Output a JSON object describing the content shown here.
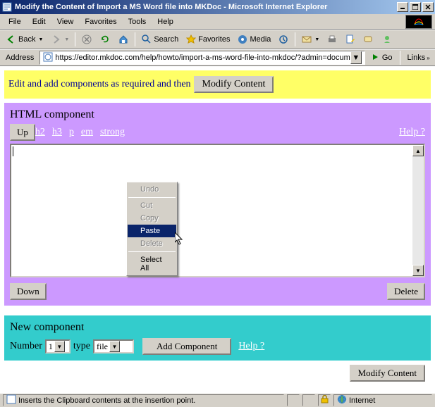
{
  "window": {
    "title": "Modify the Content of Import a MS Word file into MKDoc - Microsoft Internet Explorer"
  },
  "menubar": {
    "items": [
      "File",
      "Edit",
      "View",
      "Favorites",
      "Tools",
      "Help"
    ]
  },
  "toolbar": {
    "back": "Back",
    "search": "Search",
    "favorites": "Favorites",
    "media": "Media"
  },
  "addressbar": {
    "label": "Address",
    "url": "https://editor.mkdoc.com/help/howto/import-a-ms-word-file-into-mkdoc/?admin=docum",
    "go": "Go",
    "links": "Links"
  },
  "banner": {
    "text": "Edit and add components as required and then",
    "button": "Modify Content"
  },
  "html_component": {
    "title": "HTML component",
    "up": "Up",
    "tags": [
      "h2",
      "h3",
      "p",
      "em",
      "strong"
    ],
    "help": "Help ?",
    "down": "Down",
    "delete": "Delete"
  },
  "new_component": {
    "title": "New component",
    "number_label": "Number",
    "number_value": "1",
    "type_label": "type",
    "type_value": "file",
    "add": "Add Component",
    "help": "Help ?"
  },
  "bottom": {
    "modify": "Modify Content"
  },
  "context_menu": {
    "undo": "Undo",
    "cut": "Cut",
    "copy": "Copy",
    "paste": "Paste",
    "delete": "Delete",
    "select_all": "Select All"
  },
  "statusbar": {
    "text": "Inserts the Clipboard contents at the insertion point.",
    "zone": "Internet"
  }
}
